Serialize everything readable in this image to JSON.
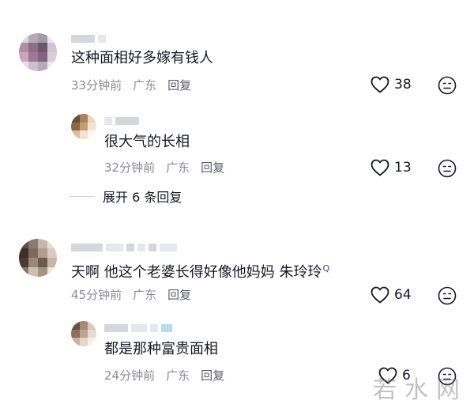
{
  "comments": [
    {
      "text": "这种面相好多嫁有钱人",
      "time": "33分钟前",
      "location": "广东",
      "reply_label": "回复",
      "likes": "38",
      "avatar_colors": [
        "#d9d6dc",
        "#b9aab8",
        "#a59aa8",
        "#e8e6ea",
        "#b08ea4",
        "#8d6e86",
        "#6f5670",
        "#cfc6cf",
        "#caa5bf",
        "#9d7896",
        "#7e6380",
        "#d7cdd7",
        "#e6dde6",
        "#cdbfd0",
        "#b7a9ba",
        "#efeaf0"
      ],
      "reply": {
        "text": "很大气的长相",
        "time": "32分钟前",
        "location": "广东",
        "reply_label": "回复",
        "likes": "13",
        "avatar_colors": [
          "#6c5036",
          "#a8825c",
          "#e7d7bd",
          "#8b6742",
          "#c39e74",
          "#f2e6d2",
          "#d8c1a0",
          "#efe4d2",
          "#fbf7f0"
        ]
      },
      "expand_label": "展开 6 条回复"
    },
    {
      "text": "天啊 他这个老婆长得好像他妈妈 ",
      "mention": "朱玲玲",
      "mention_mark": "Q",
      "time": "45分钟前",
      "location": "广东",
      "reply_label": "回复",
      "likes": "64",
      "avatar_colors": [
        "#5e5048",
        "#8c7a6e",
        "#c8b8ac",
        "#e6ddd6",
        "#3e3028",
        "#7d6a5c",
        "#b19e90",
        "#d7cbc2",
        "#4a3a30",
        "#9a8778",
        "#6d5a4c",
        "#c5b7ab",
        "#8a7566",
        "#cdbfb4",
        "#a59383",
        "#ebe3dd"
      ],
      "reply": {
        "text": "都是那种富贵面相",
        "time": "24分钟前",
        "location": "广东",
        "reply_label": "回复",
        "likes": "6",
        "avatar_colors": [
          "#6b5040",
          "#a78a74",
          "#d9c8b8",
          "#8d705c",
          "#bea48e",
          "#e8dccf",
          "#c9b4a0",
          "#e4d6c8",
          "#f6efe8"
        ]
      }
    }
  ],
  "watermark": "若水网"
}
